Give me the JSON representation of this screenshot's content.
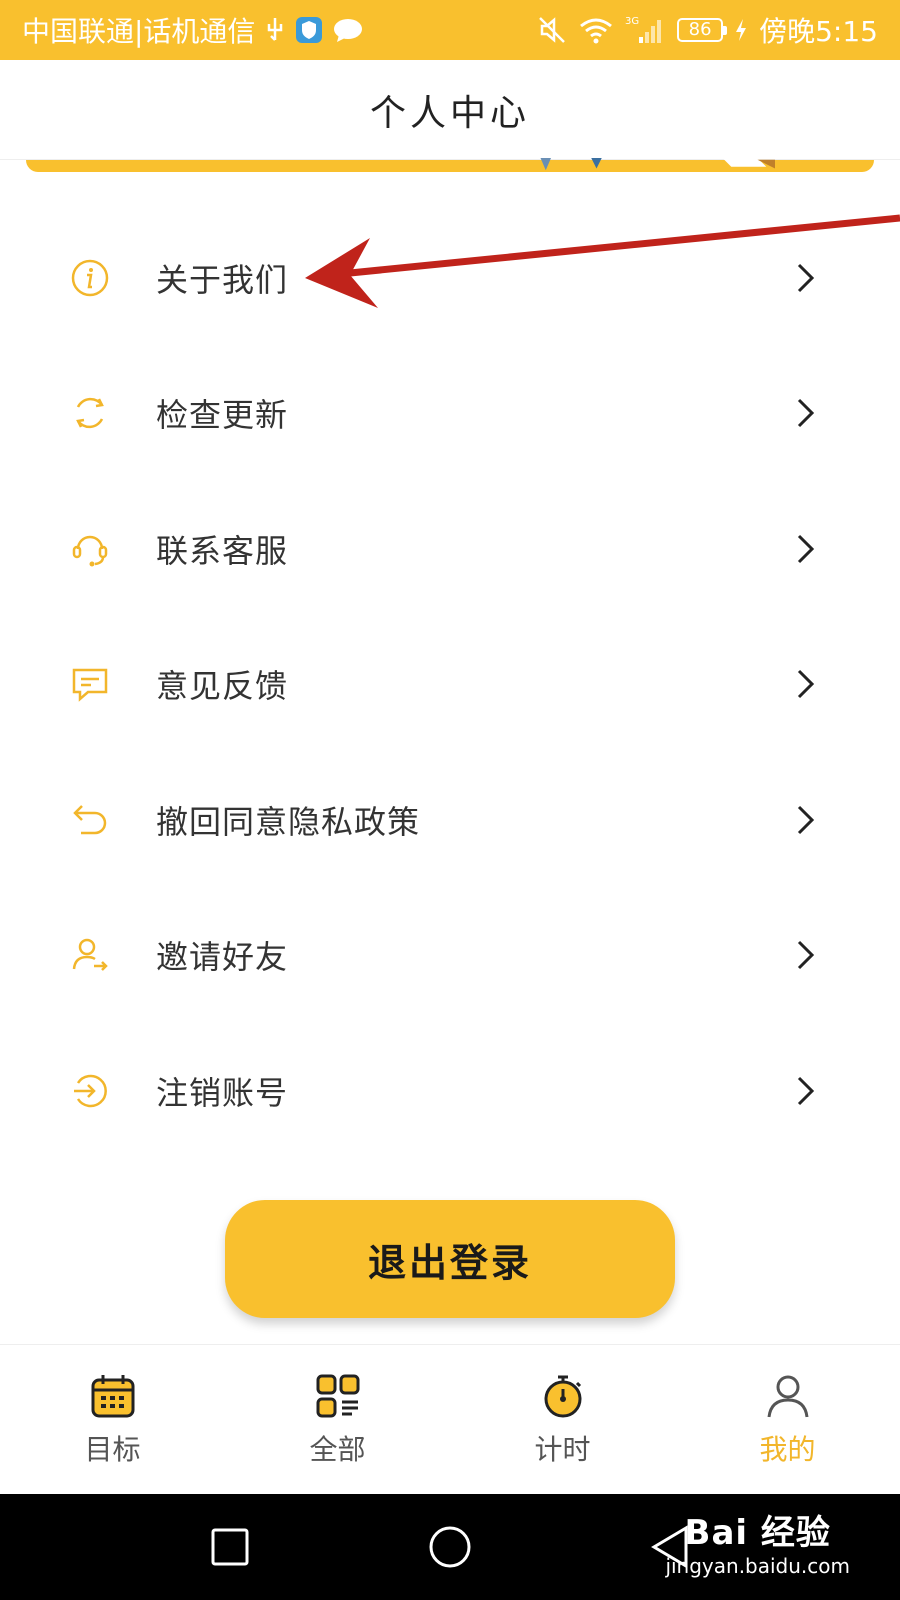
{
  "status_bar": {
    "carrier": "中国联通|话机通信",
    "battery": "86",
    "time": "傍晚5:15",
    "network": "3G",
    "icons": [
      "usb-icon",
      "shield-app-icon",
      "message-app-icon",
      "mute-icon",
      "wifi-icon",
      "signal-icon",
      "charging-icon"
    ]
  },
  "header": {
    "title": "个人中心"
  },
  "menu": {
    "items": [
      {
        "label": "关于我们",
        "icon": "info-icon"
      },
      {
        "label": "检查更新",
        "icon": "refresh-icon"
      },
      {
        "label": "联系客服",
        "icon": "headset-icon"
      },
      {
        "label": "意见反馈",
        "icon": "feedback-icon"
      },
      {
        "label": "撤回同意隐私政策",
        "icon": "undo-icon"
      },
      {
        "label": "邀请好友",
        "icon": "invite-user-icon"
      },
      {
        "label": "注销账号",
        "icon": "logout-circle-icon"
      }
    ]
  },
  "logout_button": {
    "label": "退出登录"
  },
  "tab_bar": {
    "tabs": [
      {
        "label": "目标",
        "icon": "calendar-icon",
        "active": false
      },
      {
        "label": "全部",
        "icon": "grid-icon",
        "active": false
      },
      {
        "label": "计时",
        "icon": "stopwatch-icon",
        "active": false
      },
      {
        "label": "我的",
        "icon": "user-icon",
        "active": true
      }
    ]
  },
  "watermark": {
    "brand": "Bai 经验",
    "url": "jingyan.baidu.com"
  },
  "colors": {
    "accent": "#F9C02E",
    "active_tab": "#F2B62B",
    "annotation_arrow": "#C0231B",
    "text": "#333333"
  }
}
